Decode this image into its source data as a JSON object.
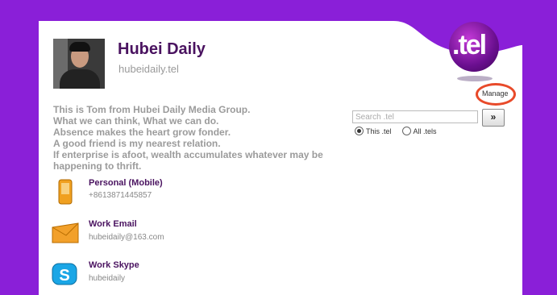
{
  "profile": {
    "name": "Hubei Daily",
    "domain": "hubeidaily.tel",
    "bio": [
      "This is Tom from Hubei Daily Media Group.",
      "What we can think, What we can do.",
      "Absence makes the heart grow fonder.",
      "A good friend is my nearest relation.",
      "If enterprise is afoot, wealth accumulates whatever may be",
      "happening to thrift."
    ]
  },
  "logo": {
    "text": ".tel"
  },
  "manage": {
    "label": "Manage"
  },
  "search": {
    "placeholder": "Search .tel",
    "button_label": "»",
    "options": [
      "This .tel",
      "All .tels"
    ],
    "selected": "This .tel"
  },
  "contacts": [
    {
      "label": "Personal (Mobile)",
      "value": "+8613871445857",
      "icon": "mobile-phone-icon"
    },
    {
      "label": "Work Email",
      "value": "hubeidaily@163.com",
      "icon": "envelope-icon"
    },
    {
      "label": "Work Skype",
      "value": "hubeidaily",
      "icon": "skype-icon"
    }
  ],
  "colors": {
    "background": "#8a1fd8",
    "title": "#4a1360",
    "manage_circle": "#e84a2a"
  }
}
